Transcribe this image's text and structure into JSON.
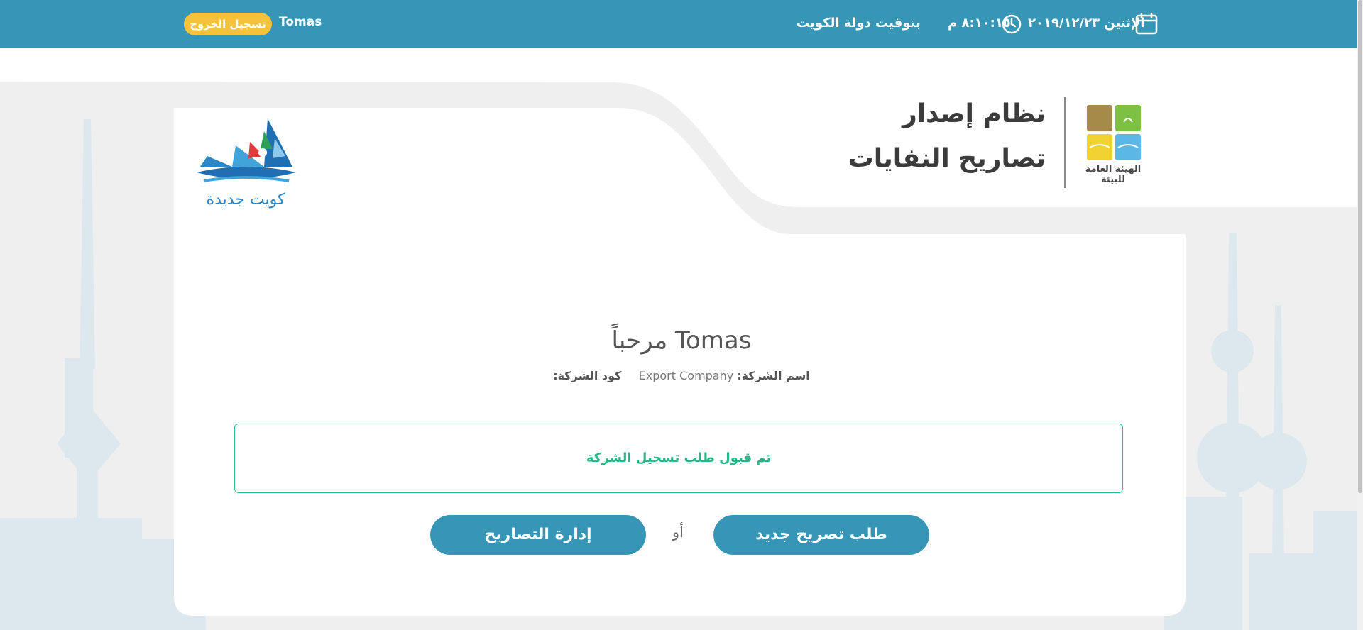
{
  "topbar": {
    "user_name": "Tomas",
    "logout_label": "تسجيل الخروج",
    "timezone_label": "بتوقيت دولة الكويت",
    "time": "٨:١٠:١٥ م",
    "date": "الإثنين ٢٠١٩/١٢/٢٣",
    "accent_color": "#3795b6",
    "logout_color": "#f5c33b"
  },
  "header": {
    "title_line1": "نظام إصدار",
    "title_line2": "تصاريح النفايات",
    "authority_name": "الهيئة العامة للبيئة",
    "authority_logo_text": "الهيئة العامة للبيئة",
    "kuwait_logo_text": "كويت جديدة"
  },
  "main": {
    "welcome": "مرحباً Tomas",
    "company_name_label": "اسم الشركة:",
    "company_name_value": "Export Company",
    "company_code_label": "كود الشركة:",
    "status_message": "تم قبول طلب تسجيل الشركة",
    "status_color": "#23b885",
    "new_permit_button": "طلب تصريح جديد",
    "or_text": "أو",
    "manage_permits_button": "إدارة التصاريح"
  }
}
